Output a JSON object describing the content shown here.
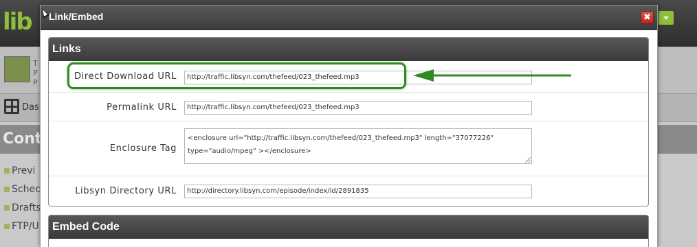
{
  "background": {
    "logo_text": "lib",
    "thumb_text": "T P P",
    "nav_label": "Das",
    "content_title": "Conte",
    "sidebar_items": [
      "Previ",
      "Schec",
      "Drafts",
      "FTP/U"
    ]
  },
  "modal": {
    "title": "Link/Embed",
    "close_icon": "close-x-icon",
    "close_glyph": "✖"
  },
  "links_panel": {
    "heading": "Links",
    "fields": [
      {
        "label": "Direct Download URL",
        "value": "http://traffic.libsyn.com/thefeed/023_thefeed.mp3"
      },
      {
        "label": "Permalink URL",
        "value": "http://traffic.libsyn.com/thefeed/023_thefeed.mp3"
      },
      {
        "label": "Enclosure Tag",
        "value": "<enclosure url=\"http://traffic.libsyn.com/thefeed/023_thefeed.mp3\" length=\"37077226\" type=\"audio/mpeg\" ></enclosure>"
      },
      {
        "label": "Libsyn Directory URL",
        "value": "http://directory.libsyn.com/episode/index/id/2891835"
      }
    ]
  },
  "embed_panel": {
    "heading": "Embed Code"
  },
  "colors": {
    "annotation_green": "#2f8a1f",
    "close_red": "#c9372c",
    "panel_header": "#444444"
  }
}
